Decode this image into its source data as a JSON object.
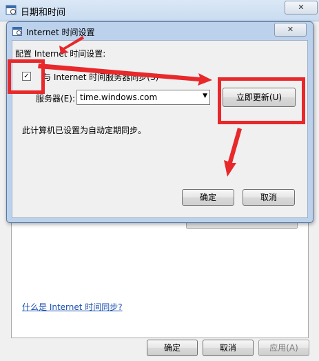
{
  "outer": {
    "title": "日期和时间",
    "close_glyph": "✕",
    "link": "什么是 Internet 时间同步?",
    "buttons": {
      "ok": "确定",
      "cancel": "取消",
      "apply": "应用(A)"
    }
  },
  "dialog": {
    "title": "Internet 时间设置",
    "close_glyph": "✕",
    "config_label": "配置 Internet 时间设置:",
    "checkbox_label": "与 Internet 时间服务器同步(S)",
    "checkbox_checked": true,
    "checkbox_glyph": "✓",
    "server_label": "服务器(E):",
    "server_value": "time.windows.com",
    "dropdown_glyph": "▼",
    "update_button": "立即更新(U)",
    "status_text": "此计算机已设置为自动定期同步。",
    "ok_button": "确定",
    "cancel_button": "取消"
  },
  "annotation_color": "#e8282a"
}
